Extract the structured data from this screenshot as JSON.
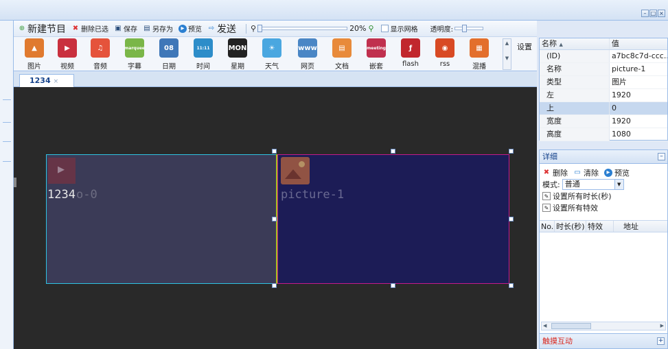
{
  "window": {
    "min": "–",
    "max": "□",
    "close": "×"
  },
  "toolbar": {
    "new_program": "新建节目",
    "delete_selected": "删除已选",
    "save": "保存",
    "save_as": "另存为",
    "preview": "预览",
    "send": "发送",
    "zoom_percent": "20%",
    "zoom_level": 0.2,
    "show_grid": "显示网格",
    "opacity_label": "透明度:"
  },
  "palette": {
    "items": [
      {
        "label": "图片",
        "icon": "image-icon",
        "color": "#e07a2f",
        "glyph": "▲"
      },
      {
        "label": "视频",
        "icon": "video-icon",
        "color": "#c9303e",
        "glyph": "▶"
      },
      {
        "label": "音频",
        "icon": "audio-icon",
        "color": "#e5533b",
        "glyph": "♫"
      },
      {
        "label": "字幕",
        "icon": "marquee-icon",
        "color": "#7ab648",
        "glyph": "marquee"
      },
      {
        "label": "日期",
        "icon": "calendar-icon",
        "color": "#3f77b8",
        "glyph": "08"
      },
      {
        "label": "时间",
        "icon": "clock-icon",
        "color": "#2d8dc9",
        "glyph": "11:11"
      },
      {
        "label": "星期",
        "icon": "weekday-icon",
        "color": "#222222",
        "glyph": "MON"
      },
      {
        "label": "天气",
        "icon": "weather-icon",
        "color": "#4aa7e0",
        "glyph": "☀"
      },
      {
        "label": "网页",
        "icon": "web-icon",
        "color": "#4a86c5",
        "glyph": "www"
      },
      {
        "label": "文档",
        "icon": "document-icon",
        "color": "#e88a3a",
        "glyph": "▤"
      },
      {
        "label": "嵌套",
        "icon": "meeting-icon",
        "color": "#c0304e",
        "glyph": "meeting"
      },
      {
        "label": "flash",
        "icon": "flash-icon",
        "color": "#c1272d",
        "glyph": "ƒ"
      },
      {
        "label": "rss",
        "icon": "rss-icon",
        "color": "#d84a24",
        "glyph": "◉"
      },
      {
        "label": "混播",
        "icon": "mix-icon",
        "color": "#e36f2c",
        "glyph": "▦"
      }
    ],
    "settings_label": "设置"
  },
  "tab": {
    "label": "1234",
    "close": "×"
  },
  "stage": {
    "region1_label": "1234",
    "region1_suffix": "o-0",
    "region2_label": "picture-1"
  },
  "properties": {
    "col_name": "名称",
    "col_value": "值",
    "rows": [
      {
        "name": "(ID)",
        "value": "a7bc8c7d-ccc..."
      },
      {
        "name": "名称",
        "value": "picture-1"
      },
      {
        "name": "类型",
        "value": "图片"
      },
      {
        "name": "左",
        "value": "1920"
      },
      {
        "name": "上",
        "value": "0"
      },
      {
        "name": "宽度",
        "value": "1920"
      },
      {
        "name": "高度",
        "value": "1080"
      }
    ]
  },
  "detail": {
    "title": "详细",
    "delete": "删除",
    "clear": "清除",
    "preview": "预览",
    "mode_label": "模式:",
    "mode_value": "普通",
    "set_all_duration": "设置所有时长(秒)",
    "set_all_effects": "设置所有特效",
    "col_no": "No.",
    "col_duration": "时长(秒)",
    "col_effect": "特效",
    "col_address": "地址",
    "footer": "触摸互动"
  },
  "colors": {
    "stage_bg": "#292929",
    "region1_border": "#2ec4e3",
    "region2_border": "#c51b8a",
    "accent": "#15428b"
  }
}
